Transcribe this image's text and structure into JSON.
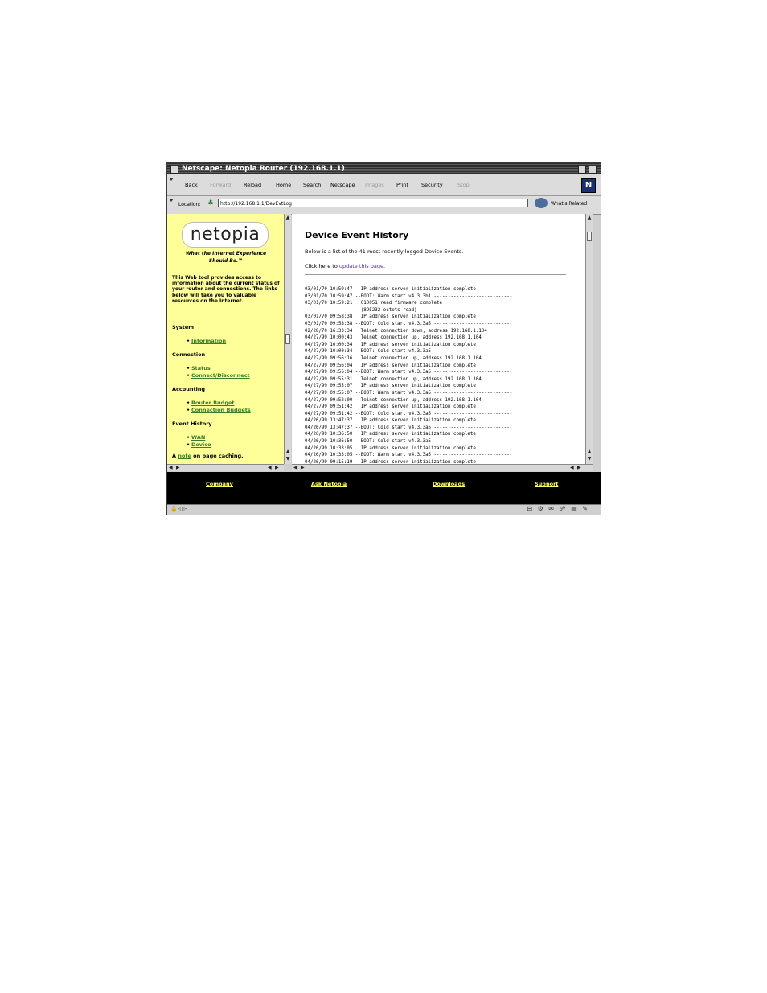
{
  "window": {
    "title": "Netscape: Netopia Router (192.168.1.1)"
  },
  "toolbar": {
    "buttons": [
      {
        "label": "Back",
        "enabled": true
      },
      {
        "label": "Forward",
        "enabled": false
      },
      {
        "label": "Reload",
        "enabled": true
      },
      {
        "label": "Home",
        "enabled": true
      },
      {
        "label": "Search",
        "enabled": true
      },
      {
        "label": "Netscape",
        "enabled": true
      },
      {
        "label": "Images",
        "enabled": false
      },
      {
        "label": "Print",
        "enabled": true
      },
      {
        "label": "Security",
        "enabled": true
      },
      {
        "label": "Stop",
        "enabled": false
      }
    ],
    "logo": "N"
  },
  "location": {
    "label": "Location:",
    "url": "http://192.168.1.1/DevEvtLog",
    "whats_related": "What's Related"
  },
  "sidebar": {
    "logo_text": "netopia",
    "tagline_1": "What the Internet Experience",
    "tagline_2": "Should Be.™",
    "intro": "This Web tool provides access to information about the current status of your router and connections. The links below will take you to valuable resources on the Internet.",
    "sections": [
      {
        "heading": "System",
        "links": [
          "Information"
        ]
      },
      {
        "heading": "Connection",
        "links": [
          "Status",
          "Connect/Disconnect"
        ]
      },
      {
        "heading": "Accounting",
        "links": [
          "Router Budget",
          "Connection Budgets"
        ]
      },
      {
        "heading": "Event History",
        "links": [
          "WAN",
          "Device"
        ]
      }
    ],
    "note_prefix": "A ",
    "note_link": "note",
    "note_suffix": " on page caching."
  },
  "main": {
    "title": "Device Event History",
    "subtitle": "Below is a list of the 41 most recently logged Device Events.",
    "click_prefix": "Click here to ",
    "click_link": "update this page",
    "click_suffix": ".",
    "log_lines": [
      "03/01/70 10:59:47   IP address server initialization complete",
      "03/01/70 10:59:47 --BOOT: Warm start v4.3.3b1 ----------------------------",
      "03/01/70 10:59:21   010051 read firmware complete",
      "                    (895232 octets read)",
      "03/01/70 09:58:38   IP address server initialization complete",
      "03/01/70 09:58:38 --BOOT: Cold start v4.3.3a5 ----------------------------",
      "02/28/70 16:33:34   Telnet connection down, address 192.168.1.104",
      "04/27/99 10:00:43   Telnet connection up, address 192.168.1.104",
      "04/27/99 10:00:34   IP address server initialization complete",
      "04/27/99 10:00:34 --BOOT: Cold start v4.3.3a5 ----------------------------",
      "04/27/99 09:56:16   Telnet connection up, address 192.168.1.104",
      "04/27/99 09:56:04   IP address server initialization complete",
      "04/27/99 09:56:04 --BOOT: Warm start v4.3.3a5 ----------------------------",
      "04/27/99 09:55:31   Telnet connection up, address 192.168.1.104",
      "04/27/99 09:55:07   IP address server initialization complete",
      "04/27/99 09:55:07 --BOOT: Warm start v4.3.3a5 ----------------------------",
      "04/27/99 09:52:00   Telnet connection up, address 192.168.1.104",
      "04/27/99 09:51:42   IP address server initialization complete",
      "04/27/99 09:51:42 --BOOT: Cold start v4.3.3a5 ----------------------------",
      "04/26/99 13:47:37   IP address server initialization complete",
      "04/26/99 13:47:37 --BOOT: Cold start v4.3.3a5 ----------------------------",
      "04/26/99 10:36:50   IP address server initialization complete",
      "04/26/99 10:36:50 --BOOT: Cold start v4.3.3a5 ----------------------------",
      "04/26/99 10:33:05   IP address server initialization complete",
      "04/26/99 10:33:05 --BOOT: Warm start v4.3.3a5 ----------------------------",
      "04/26/99 09:15:19   IP address server initialization complete"
    ]
  },
  "footer": {
    "links": [
      "Company",
      "Ask Netopia",
      "Downloads",
      "Support"
    ]
  },
  "status": {
    "lock": "🔓-◫-",
    "components": "⊟ ⚙ ✉ ☍ ▤ ✎"
  }
}
